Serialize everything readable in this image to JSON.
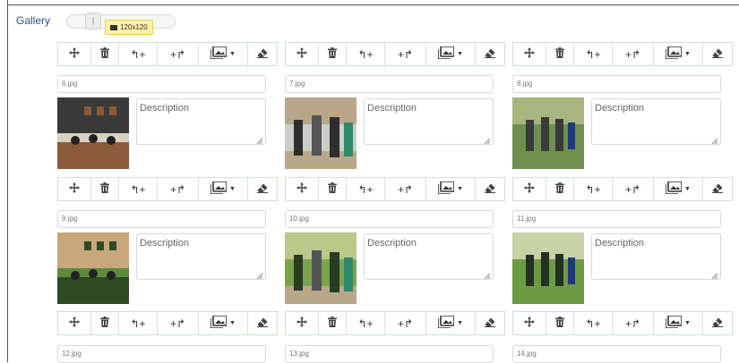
{
  "gallery": {
    "label": "Gallery",
    "thumb_size_label": "120x120",
    "slider_value_fraction": 0.25
  },
  "toolbar": {
    "move_icon": "move-icon",
    "delete_icon": "trash-icon",
    "undo_label": "↰+",
    "redo_label": "+↱",
    "image_icon": "image-icon",
    "erase_icon": "eraser-icon"
  },
  "items": [
    {
      "filename": "6.jpg",
      "description_placeholder": "Description",
      "photo": "meeting-room",
      "thumb_colors": [
        "#d9d2c4",
        "#8a5a3a",
        "#3a3a3a"
      ]
    },
    {
      "filename": "7.jpg",
      "description_placeholder": "Description",
      "photo": "people-standing",
      "thumb_colors": [
        "#c9cfc6",
        "#2e2e2e",
        "#b9a78a"
      ]
    },
    {
      "filename": "8.jpg",
      "description_placeholder": "Description",
      "photo": "garden-group",
      "thumb_colors": [
        "#6f8f4f",
        "#3a3a3a",
        "#a7b57e"
      ]
    },
    {
      "filename": "9.jpg",
      "description_placeholder": "Description",
      "photo": "banana-plants",
      "thumb_colors": [
        "#5d8a3c",
        "#2d4a22",
        "#c9a77c"
      ]
    },
    {
      "filename": "10.jpg",
      "description_placeholder": "Description",
      "photo": "field-visit",
      "thumb_colors": [
        "#7aa34d",
        "#2a3b24",
        "#b8c98a"
      ]
    },
    {
      "filename": "11.jpg",
      "description_placeholder": "Description",
      "photo": "orchard-group",
      "thumb_colors": [
        "#6e9a44",
        "#233022",
        "#c8d2a4"
      ]
    },
    {
      "filename": "12.jpg"
    },
    {
      "filename": "13.jpg"
    },
    {
      "filename": "14.jpg"
    }
  ]
}
